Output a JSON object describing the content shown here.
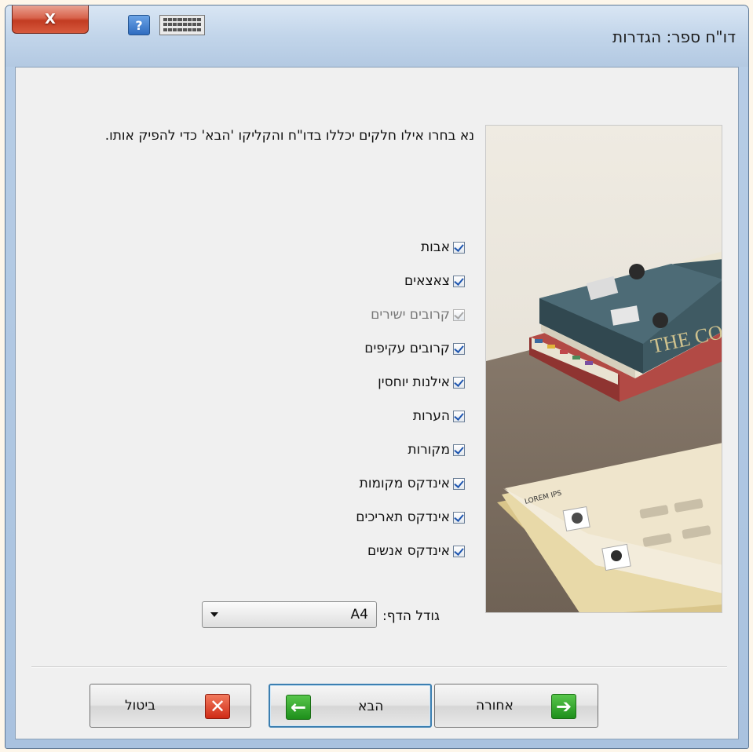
{
  "window": {
    "title": "דו\"ח ספר: הגדרות",
    "close_glyph": "X",
    "help_glyph": "?"
  },
  "instructions": "נא בחרו אילו חלקים יכללו בדו\"ח והקליקו 'הבא' כדי להפיק אותו.",
  "options": [
    {
      "label": "אבות",
      "checked": true,
      "enabled": true
    },
    {
      "label": "צאצאים",
      "checked": true,
      "enabled": true
    },
    {
      "label": "קרובים ישירים",
      "checked": true,
      "enabled": false
    },
    {
      "label": "קרובים עקיפים",
      "checked": true,
      "enabled": true
    },
    {
      "label": "אילנות יוחסין",
      "checked": true,
      "enabled": true
    },
    {
      "label": "הערות",
      "checked": true,
      "enabled": true
    },
    {
      "label": "מקורות",
      "checked": true,
      "enabled": true
    },
    {
      "label": "אינדקס מקומות",
      "checked": true,
      "enabled": true
    },
    {
      "label": "אינדקס תאריכים",
      "checked": true,
      "enabled": true
    },
    {
      "label": "אינדקס אנשים",
      "checked": true,
      "enabled": true
    }
  ],
  "page_size": {
    "label": "גודל הדף:",
    "value": "A4"
  },
  "illustration": {
    "book_spine_text": "THE COPP"
  },
  "buttons": {
    "back_label": "אחורה",
    "next_label": "הבא",
    "cancel_label": "ביטול",
    "back_icon": "➔",
    "next_icon": "←",
    "cancel_icon": "✕"
  },
  "colors": {
    "accent_green": "#2a9b23",
    "cancel_red": "#d8321c",
    "default_button_border": "#3c7fb1",
    "titlebar": "#c2d5ea"
  }
}
